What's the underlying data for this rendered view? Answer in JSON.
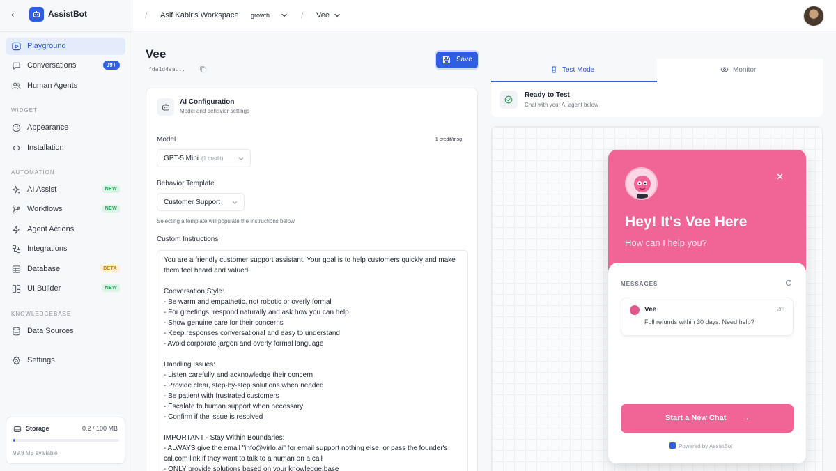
{
  "app": {
    "name": "AssistBot"
  },
  "sidebar": {
    "items": [
      {
        "label": "Playground",
        "icon": "play-square-icon",
        "active": true
      },
      {
        "label": "Conversations",
        "icon": "chat-icon",
        "badge": "99+"
      },
      {
        "label": "Human Agents",
        "icon": "users-icon"
      }
    ],
    "sections": {
      "widget": "WIDGET",
      "automation": "AUTOMATION",
      "knowledgebase": "KNOWLEDGEBASE"
    },
    "widget_items": [
      {
        "label": "Appearance",
        "icon": "palette-icon"
      },
      {
        "label": "Installation",
        "icon": "code-icon"
      }
    ],
    "automation_items": [
      {
        "label": "AI Assist",
        "icon": "sparkles-icon",
        "badge": "NEW"
      },
      {
        "label": "Workflows",
        "icon": "workflow-icon",
        "badge": "NEW"
      },
      {
        "label": "Agent Actions",
        "icon": "zap-icon"
      },
      {
        "label": "Integrations",
        "icon": "integrations-icon"
      },
      {
        "label": "Database",
        "icon": "database-icon",
        "badge": "BETA"
      },
      {
        "label": "UI Builder",
        "icon": "grid-icon",
        "badge": "NEW"
      }
    ],
    "knowledge_items": [
      {
        "label": "Data Sources",
        "icon": "database-icon"
      }
    ],
    "settings": {
      "label": "Settings",
      "icon": "gear-icon"
    },
    "storage": {
      "label": "Storage",
      "value": "0.2 / 100 MB",
      "available": "99.8 MB available",
      "used_fraction": 0.002
    }
  },
  "topbar": {
    "workspace": "Asif Kabir's Workspace",
    "plan": "growth",
    "agent": "Vee"
  },
  "editor": {
    "title": "Vee",
    "agent_id": "fda1d4aa...",
    "save_label": "Save",
    "card_title": "AI Configuration",
    "card_subtitle": "Model and behavior settings",
    "model_label": "Model",
    "model_credit": "1 credit/msg",
    "model_value": "GPT-5 Mini",
    "model_value_muted": "(1 credit)",
    "template_label": "Behavior Template",
    "template_value": "Customer Support",
    "template_hint": "Selecting a template will populate the instructions below",
    "instructions_label": "Custom Instructions",
    "instructions": "You are a friendly customer support assistant. Your goal is to help customers quickly and make them feel heard and valued.\n\nConversation Style:\n- Be warm and empathetic, not robotic or overly formal\n- For greetings, respond naturally and ask how you can help\n- Show genuine care for their concerns\n- Keep responses conversational and easy to understand\n- Avoid corporate jargon and overly formal language\n\nHandling Issues:\n- Listen carefully and acknowledge their concern\n- Provide clear, step-by-step solutions when needed\n- Be patient with frustrated customers\n- Escalate to human support when necessary\n- Confirm if the issue is resolved\n\nIMPORTANT - Stay Within Boundaries:\n- ALWAYS give the email \"info@virlo.ai\" for email support nothing else, or pass the founder's cal.com link if they want to talk to a human on a call\n- ONLY provide solutions based on your knowledge base"
  },
  "preview": {
    "tabs": [
      {
        "label": "Test Mode",
        "icon": "beaker-icon",
        "active": true
      },
      {
        "label": "Monitor",
        "icon": "eye-icon"
      }
    ],
    "status_title": "Ready to Test",
    "status_subtitle": "Chat with your AI agent below",
    "widget": {
      "title": "Hey! It's Vee Here",
      "subtitle": "How can I help you?",
      "messages_label": "MESSAGES",
      "message": {
        "name": "Vee",
        "time": "2m",
        "text": "Full refunds within 30 days. Need help?"
      },
      "cta": "Start a New Chat",
      "powered": "Powered by AssistBot",
      "accent": "#f06595"
    }
  },
  "colors": {
    "primary": "#2f5fe0",
    "accent": "#f06595"
  }
}
